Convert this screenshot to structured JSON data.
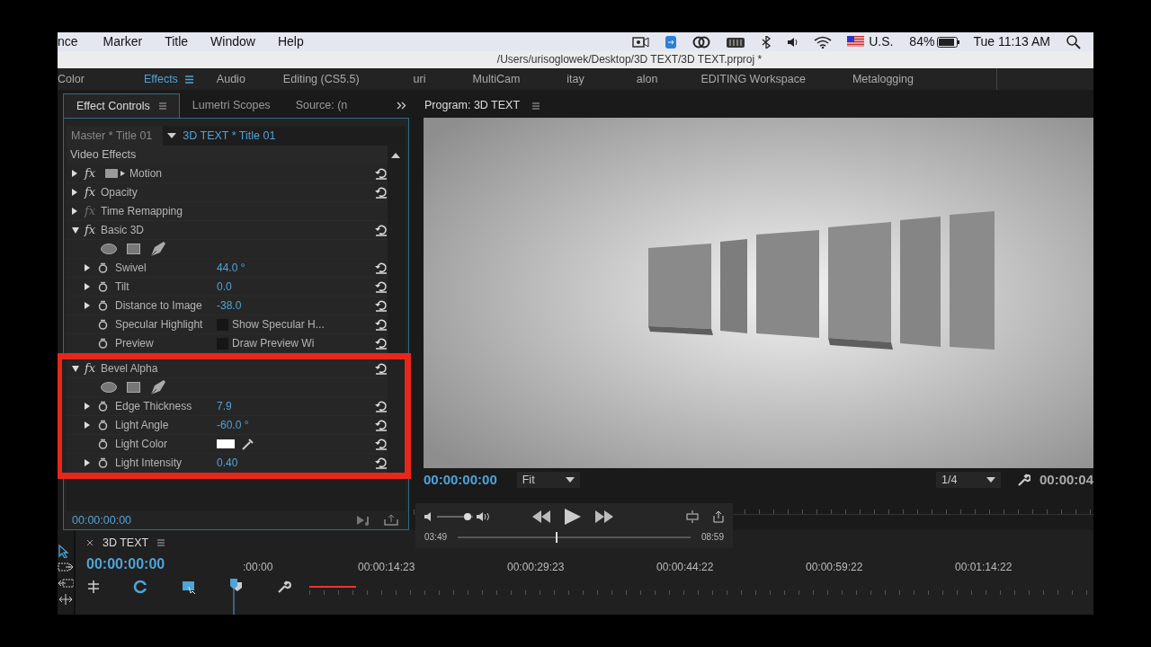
{
  "menu_bar": {
    "items": [
      "nce",
      "Marker",
      "Title",
      "Window",
      "Help"
    ],
    "input_source": "U.S.",
    "battery": "84%",
    "clock": "Tue 11:13 AM"
  },
  "title_bar": {
    "path": "/Users/urisoglowek/Desktop/3D TEXT/3D TEXT.prproj *"
  },
  "workspaces": [
    {
      "label": "Color",
      "selected": false
    },
    {
      "label": "Effects",
      "selected": true
    },
    {
      "label": "Audio",
      "selected": false
    },
    {
      "label": "Editing (CS5.5)",
      "selected": false
    },
    {
      "label": "uri",
      "selected": false
    },
    {
      "label": "MultiCam",
      "selected": false
    },
    {
      "label": "itay",
      "selected": false
    },
    {
      "label": "alon",
      "selected": false
    },
    {
      "label": "EDITING Workspace",
      "selected": false
    },
    {
      "label": "Metalogging",
      "selected": false
    }
  ],
  "effect_panel": {
    "tabs": [
      {
        "label": "Effect Controls",
        "selected": true
      },
      {
        "label": "Lumetri Scopes",
        "selected": false
      },
      {
        "label": "Source: (n",
        "selected": false
      }
    ],
    "master_clip": "Master * Title 01",
    "sequence_clip": "3D TEXT * Title 01",
    "section": "Video Effects",
    "effects": [
      {
        "name": "Motion",
        "fx": "fx",
        "expanded": false,
        "disabled": false,
        "motion_icon": true,
        "reset": true
      },
      {
        "name": "Opacity",
        "fx": "fx",
        "expanded": false,
        "disabled": false,
        "reset": true
      },
      {
        "name": "Time Remapping",
        "fx": "fx",
        "expanded": false,
        "disabled": true
      },
      {
        "name": "Basic 3D",
        "fx": "fx",
        "expanded": true,
        "disabled": false,
        "reset": true,
        "shape_tools": true,
        "properties": [
          {
            "kind": "number",
            "name": "Swivel",
            "value": "44.0 °"
          },
          {
            "kind": "number",
            "name": "Tilt",
            "value": "0.0"
          },
          {
            "kind": "number",
            "name": "Distance to Image",
            "value": "-38.0"
          },
          {
            "kind": "checkbox",
            "name": "Specular Highlight",
            "value": "Show Specular H...",
            "checked": false
          },
          {
            "kind": "checkbox",
            "name": "Preview",
            "value": "Draw Preview Wi",
            "checked": false
          }
        ]
      },
      {
        "name": "Bevel Alpha",
        "fx": "fx",
        "expanded": true,
        "disabled": false,
        "highlighted": true,
        "reset": true,
        "shape_tools": true,
        "properties": [
          {
            "kind": "number",
            "name": "Edge Thickness",
            "value": "7.9"
          },
          {
            "kind": "number",
            "name": "Light Angle",
            "value": "-60.0 °"
          },
          {
            "kind": "color",
            "name": "Light Color",
            "color": "#ffffff"
          },
          {
            "kind": "number",
            "name": "Light Intensity",
            "value": "0.40"
          }
        ]
      }
    ],
    "timecode": "00:00:00:00"
  },
  "program_monitor": {
    "title": "Program: 3D TEXT",
    "timecode": "00:00:00:00",
    "zoom": "Fit",
    "resolution": "1/4",
    "duration": "00:00:04"
  },
  "player_overlay": {
    "elapsed": "03:49",
    "total": "08:59",
    "volume": {
      "level": 0.85
    },
    "progress": {
      "level": 0.42
    }
  },
  "timeline": {
    "tab": "3D TEXT",
    "timecode": "00:00:00:00",
    "ruler": [
      ":00:00",
      "00:00:14:23",
      "00:00:29:23",
      "00:00:44:22",
      "00:00:59:22",
      "00:01:14:22"
    ]
  }
}
